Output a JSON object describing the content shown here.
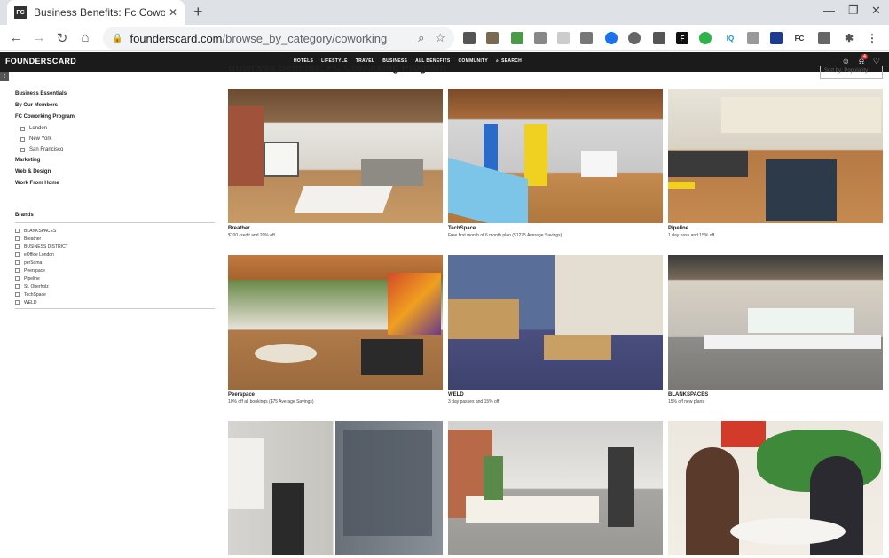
{
  "browser": {
    "tab_title": "Business Benefits: Fc Coworking",
    "favicon_text": "FC",
    "url_host": "founderscard.com",
    "url_path": "/browse_by_category/coworking"
  },
  "site": {
    "logo": "FOUNDERSCARD",
    "nav": [
      "HOTELS",
      "LIFESTYLE",
      "TRAVEL",
      "BUSINESS",
      "ALL BENEFITS",
      "COMMUNITY",
      "SEARCH"
    ],
    "notif_count": "4"
  },
  "page": {
    "title": "Business Benefits: FC Coworking Program",
    "sort_label": "Sort by: Popularity"
  },
  "sidebar": {
    "categories": [
      {
        "label": "Business Essentials"
      },
      {
        "label": "By Our Members"
      },
      {
        "label": "FC Coworking Program"
      }
    ],
    "subcategories": [
      "London",
      "New York",
      "San Francisco"
    ],
    "more_categories": [
      "Marketing",
      "Web & Design",
      "Work From Home"
    ],
    "brands_heading": "Brands",
    "brands": [
      "BLANKSPACES",
      "Breather",
      "BUSINESS DISTRICT",
      "eOffice London",
      "perSoma",
      "Peerspace",
      "Pipeline",
      "St. Oberholz",
      "TechSpace",
      "WELD"
    ]
  },
  "cards": [
    {
      "name": "Breather",
      "desc": "$100 credit and 20% off"
    },
    {
      "name": "TechSpace",
      "desc": "Free first month of 6 month plan ($1275 Average Savings)"
    },
    {
      "name": "Pipeline",
      "desc": "1 day pass and 15% off"
    },
    {
      "name": "Peerspace",
      "desc": "10% off all bookings ($75 Average Savings)"
    },
    {
      "name": "WELD",
      "desc": "3 day passes and 15% off"
    },
    {
      "name": "BLANKSPACES",
      "desc": "15% off new plans"
    },
    {
      "name": "",
      "desc": ""
    },
    {
      "name": "",
      "desc": ""
    },
    {
      "name": "",
      "desc": ""
    }
  ]
}
